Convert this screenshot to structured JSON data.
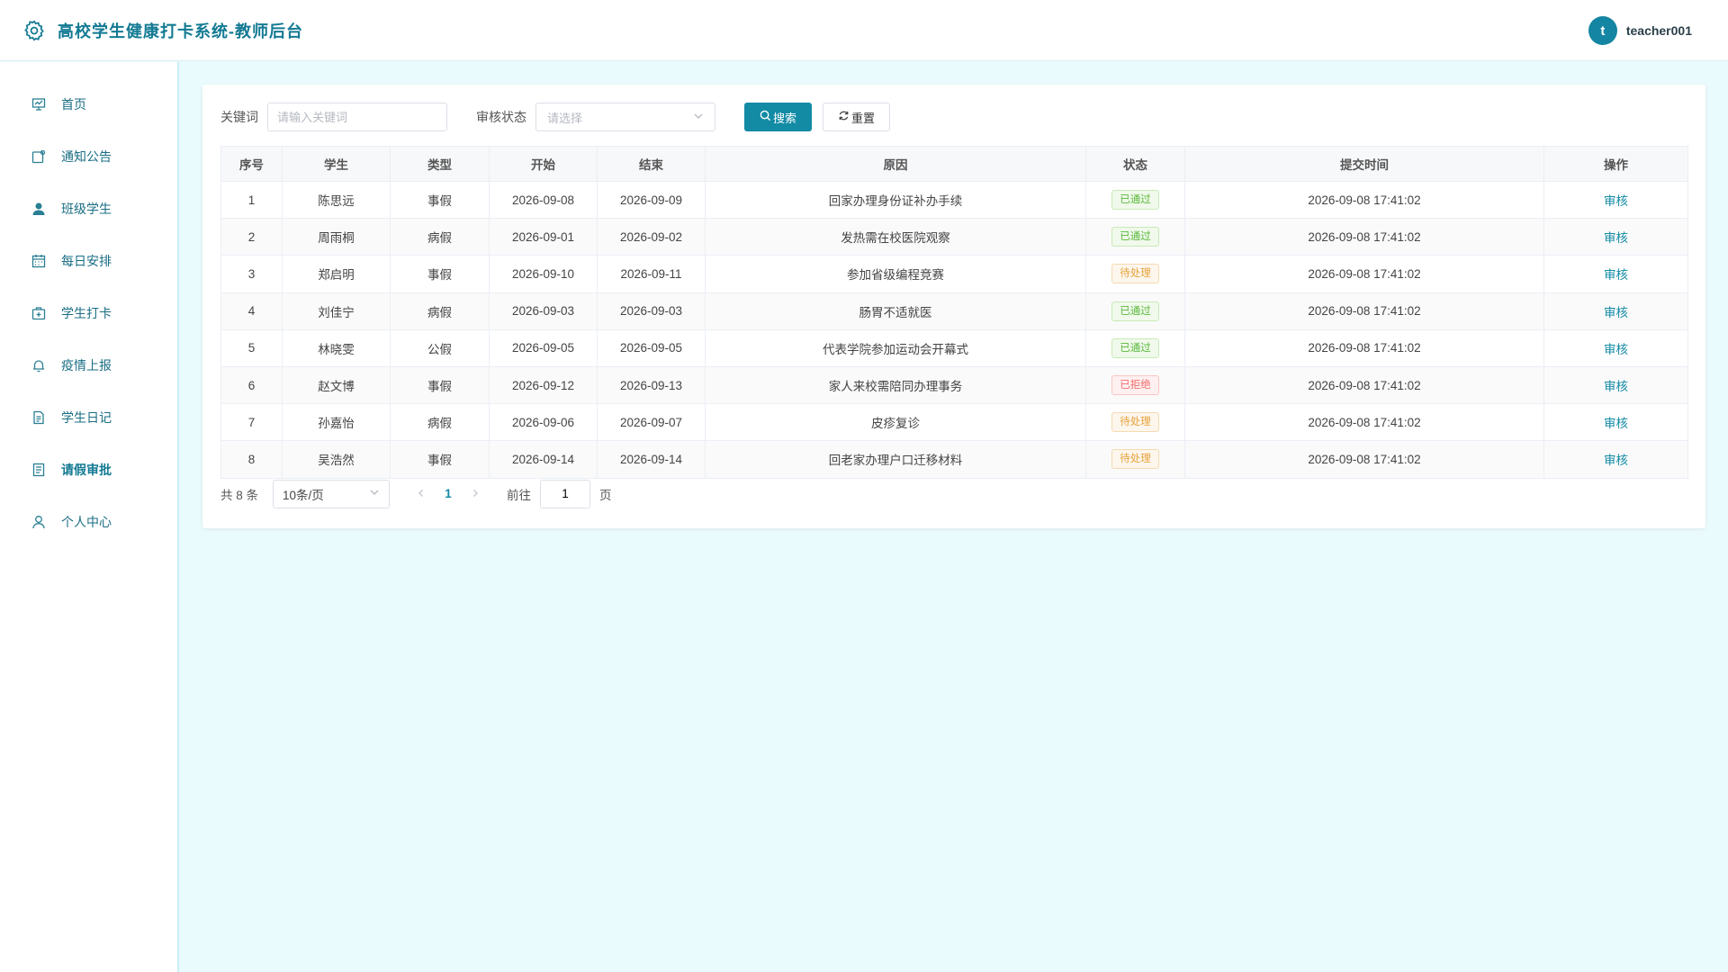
{
  "header": {
    "title": "高校学生健康打卡系统-教师后台",
    "avatar_letter": "t",
    "username": "teacher001",
    "accent": "#137a93"
  },
  "sidebar": {
    "items": [
      {
        "label": "首页",
        "icon": "dashboard-icon"
      },
      {
        "label": "通知公告",
        "icon": "notice-icon"
      },
      {
        "label": "班级学生",
        "icon": "user-filled-icon"
      },
      {
        "label": "每日安排",
        "icon": "calendar-icon"
      },
      {
        "label": "学生打卡",
        "icon": "first-aid-kit-icon"
      },
      {
        "label": "疫情上报",
        "icon": "bell-icon"
      },
      {
        "label": "学生日记",
        "icon": "document-icon"
      },
      {
        "label": "请假审批",
        "icon": "tickets-icon",
        "active": true
      },
      {
        "label": "个人中心",
        "icon": "user-icon"
      }
    ]
  },
  "filters": {
    "keyword_label": "关键词",
    "keyword_placeholder": "请输入关键词",
    "keyword_value": "",
    "status_label": "审核状态",
    "status_placeholder": "请选择",
    "search_label": "搜索",
    "reset_label": "重置"
  },
  "table": {
    "columns": [
      "序号",
      "学生",
      "类型",
      "开始",
      "结束",
      "原因",
      "状态",
      "提交时间",
      "操作"
    ],
    "rows": [
      {
        "no": "1",
        "student": "陈思远",
        "type": "事假",
        "start": "2026-09-08",
        "end": "2026-09-09",
        "reason": "回家办理身份证补办手续",
        "status": "已通过",
        "status_kind": "ok",
        "submitted": "2026-09-08 17:41:02",
        "action": "审核"
      },
      {
        "no": "2",
        "student": "周雨桐",
        "type": "病假",
        "start": "2026-09-01",
        "end": "2026-09-02",
        "reason": "发热需在校医院观察",
        "status": "已通过",
        "status_kind": "ok",
        "submitted": "2026-09-08 17:41:02",
        "action": "审核"
      },
      {
        "no": "3",
        "student": "郑启明",
        "type": "事假",
        "start": "2026-09-10",
        "end": "2026-09-11",
        "reason": "参加省级编程竞赛",
        "status": "待处理",
        "status_kind": "wait",
        "submitted": "2026-09-08 17:41:02",
        "action": "审核"
      },
      {
        "no": "4",
        "student": "刘佳宁",
        "type": "病假",
        "start": "2026-09-03",
        "end": "2026-09-03",
        "reason": "肠胃不适就医",
        "status": "已通过",
        "status_kind": "ok",
        "submitted": "2026-09-08 17:41:02",
        "action": "审核"
      },
      {
        "no": "5",
        "student": "林晓雯",
        "type": "公假",
        "start": "2026-09-05",
        "end": "2026-09-05",
        "reason": "代表学院参加运动会开幕式",
        "status": "已通过",
        "status_kind": "ok",
        "submitted": "2026-09-08 17:41:02",
        "action": "审核"
      },
      {
        "no": "6",
        "student": "赵文博",
        "type": "事假",
        "start": "2026-09-12",
        "end": "2026-09-13",
        "reason": "家人来校需陪同办理事务",
        "status": "已拒绝",
        "status_kind": "rej",
        "submitted": "2026-09-08 17:41:02",
        "action": "审核"
      },
      {
        "no": "7",
        "student": "孙嘉怡",
        "type": "病假",
        "start": "2026-09-06",
        "end": "2026-09-07",
        "reason": "皮疹复诊",
        "status": "待处理",
        "status_kind": "wait",
        "submitted": "2026-09-08 17:41:02",
        "action": "审核"
      },
      {
        "no": "8",
        "student": "吴浩然",
        "type": "事假",
        "start": "2026-09-14",
        "end": "2026-09-14",
        "reason": "回老家办理户口迁移材料",
        "status": "待处理",
        "status_kind": "wait",
        "submitted": "2026-09-08 17:41:02",
        "action": "审核"
      }
    ]
  },
  "pagination": {
    "total_text": "共 8 条",
    "page_size": "10条/页",
    "current_page": "1",
    "goto_label": "前往",
    "goto_value": "1",
    "page_suffix": "页"
  }
}
